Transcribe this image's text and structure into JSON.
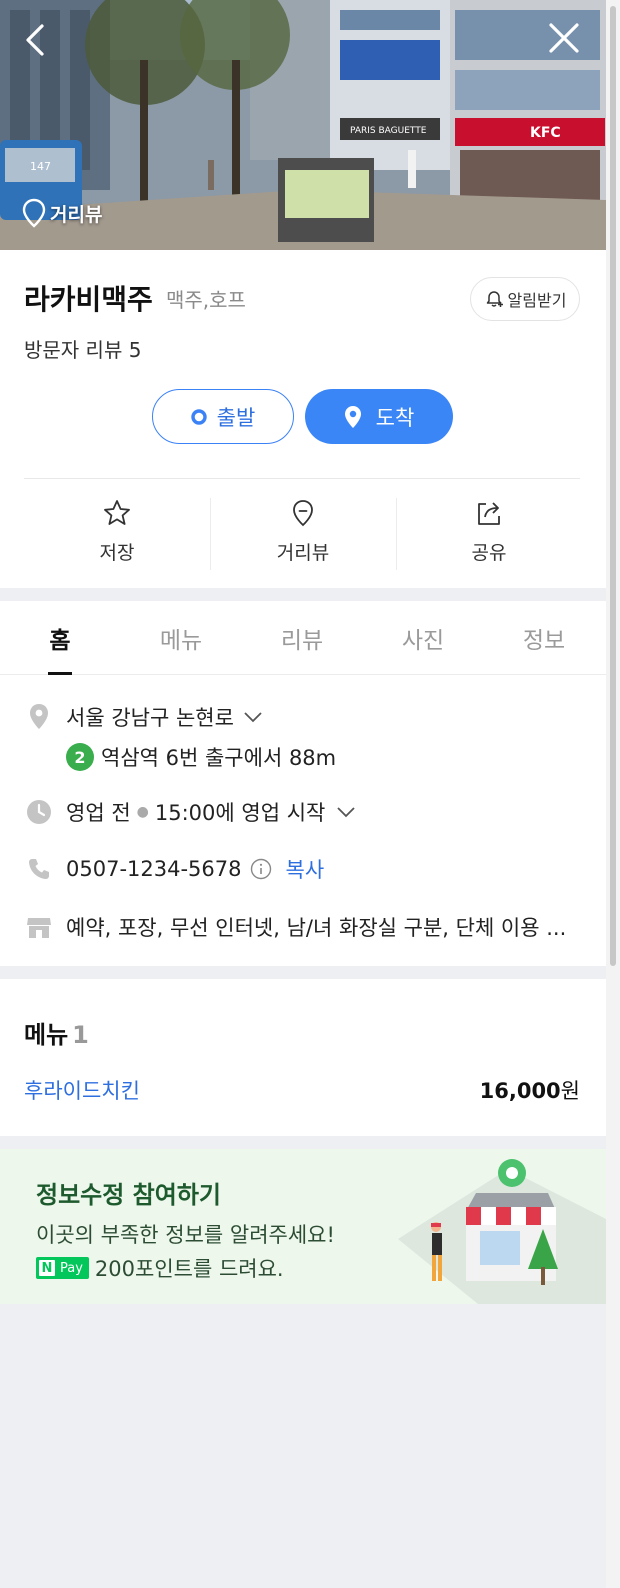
{
  "hero": {
    "back_icon": "chevron-left-icon",
    "close_icon": "close-icon",
    "streetview_label": "거리뷰",
    "sign_kfc": "KFC",
    "sign_bakery": "PARIS BAGUETTE",
    "bus_number": "147"
  },
  "place": {
    "name": "라카비맥주",
    "category": "맥주,호프",
    "alarm_label": "알림받기",
    "review_count": "방문자 리뷰 5"
  },
  "route": {
    "depart_label": "출발",
    "arrive_label": "도착"
  },
  "actions": [
    {
      "label": "저장",
      "icon": "star-icon"
    },
    {
      "label": "거리뷰",
      "icon": "location-pin-icon"
    },
    {
      "label": "공유",
      "icon": "share-icon"
    }
  ],
  "tabs": [
    {
      "label": "홈",
      "active": true
    },
    {
      "label": "메뉴",
      "active": false
    },
    {
      "label": "리뷰",
      "active": false
    },
    {
      "label": "사진",
      "active": false
    },
    {
      "label": "정보",
      "active": false
    }
  ],
  "details": {
    "address": "서울 강남구 논현로",
    "subway_line": "2",
    "subway_line_color": "#3aad4c",
    "subway_text": "역삼역 6번 출구에서 88m",
    "status": "영업 전",
    "hours": "15:00에 영업 시작",
    "phone": "0507-1234-5678",
    "copy_label": "복사",
    "amenities": "예약, 포장, 무선 인터넷, 남/녀 화장실 구분, 단체 이용 ..."
  },
  "menu": {
    "title": "메뉴",
    "count": "1",
    "items": [
      {
        "name": "후라이드치킨",
        "price": "16,000",
        "unit": "원"
      }
    ]
  },
  "banner": {
    "title": "정보수정 참여하기",
    "line1": "이곳의 부족한 정보를 알려주세요!",
    "npay_n": "N",
    "npay_pay": "Pay",
    "line2": "200포인트를 드려요."
  },
  "colors": {
    "accent_blue": "#3b86f7",
    "link_blue": "#2e6fe0",
    "banner_bg": "#eef7ec",
    "npay_green": "#03c75a"
  }
}
